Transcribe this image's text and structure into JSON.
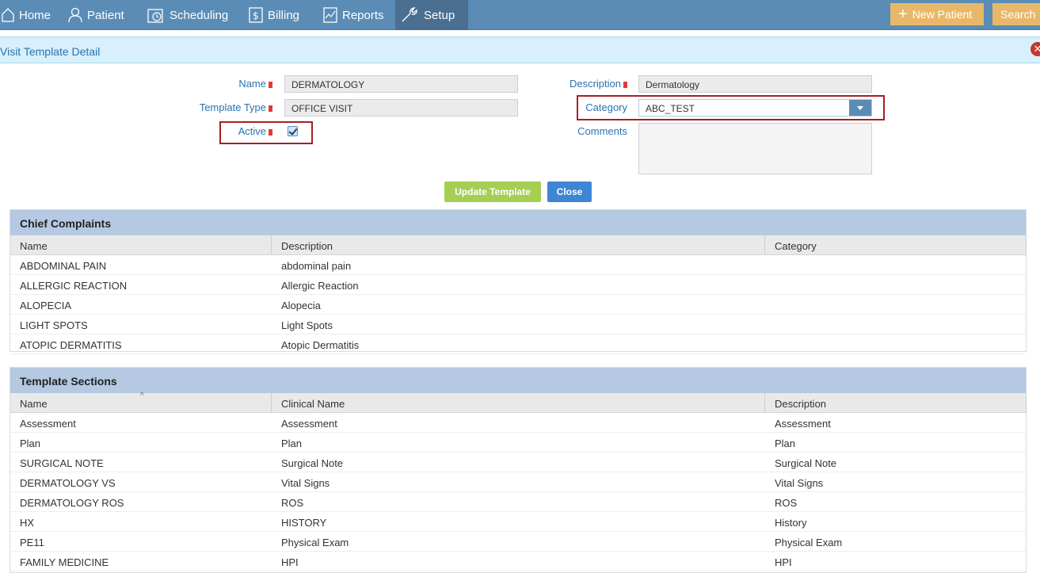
{
  "nav": {
    "items": [
      {
        "label": "Home",
        "icon": "home-icon"
      },
      {
        "label": "Patient",
        "icon": "user-icon"
      },
      {
        "label": "Scheduling",
        "icon": "calendar-clock-icon"
      },
      {
        "label": "Billing",
        "icon": "dollar-icon"
      },
      {
        "label": "Reports",
        "icon": "chart-icon"
      },
      {
        "label": "Setup",
        "icon": "wrench-icon"
      }
    ],
    "new_patient": "New Patient",
    "search": "Search"
  },
  "titlebar": {
    "title": "Visit Template Detail"
  },
  "form": {
    "name_label": "Name",
    "name_value": "DERMATOLOGY",
    "template_type_label": "Template Type",
    "template_type_value": "OFFICE VISIT",
    "active_label": "Active",
    "active_checked": true,
    "description_label": "Description",
    "description_value": "Dermatology",
    "category_label": "Category",
    "category_value": "ABC_TEST",
    "comments_label": "Comments",
    "comments_value": "",
    "update_button": "Update Template",
    "close_button": "Close"
  },
  "chief_complaints": {
    "title": "Chief Complaints",
    "columns": [
      "Name",
      "Description",
      "Category"
    ],
    "rows": [
      [
        "ABDOMINAL PAIN",
        "abdominal pain",
        ""
      ],
      [
        "ALLERGIC REACTION",
        "Allergic Reaction",
        ""
      ],
      [
        "ALOPECIA",
        "Alopecia",
        ""
      ],
      [
        "LIGHT SPOTS",
        "Light Spots",
        ""
      ],
      [
        "ATOPIC DERMATITIS",
        "Atopic Dermatitis",
        ""
      ]
    ]
  },
  "template_sections": {
    "title": "Template Sections",
    "columns": [
      "Name",
      "Clinical Name",
      "Description"
    ],
    "rows": [
      [
        "Assessment",
        "Assessment",
        "Assessment"
      ],
      [
        "Plan",
        "Plan",
        "Plan"
      ],
      [
        "SURGICAL NOTE",
        "Surgical Note",
        "Surgical Note"
      ],
      [
        "DERMATOLOGY VS",
        "Vital Signs",
        "Vital Signs"
      ],
      [
        "DERMATOLOGY ROS",
        "ROS",
        "ROS"
      ],
      [
        "HX",
        "HISTORY",
        "History"
      ],
      [
        "PE11",
        "Physical Exam",
        "Physical Exam"
      ],
      [
        "FAMILY MEDICINE",
        "HPI",
        "HPI"
      ]
    ]
  },
  "colors": {
    "nav": "#5b8cb6",
    "accent": "#e8b86a",
    "update": "#a5cf52",
    "close": "#3f85d5"
  }
}
